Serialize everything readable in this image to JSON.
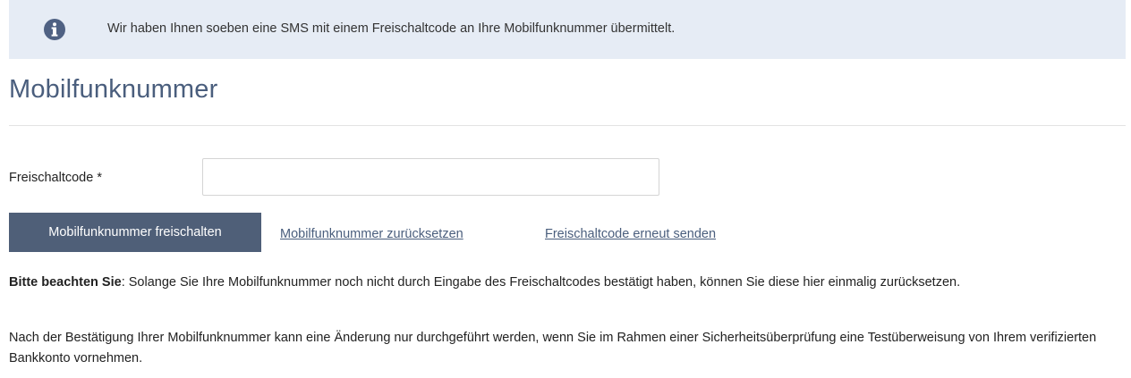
{
  "alert": {
    "icon": "info-circle-icon",
    "color": "#e6ecf5",
    "message": "Wir haben Ihnen soeben eine SMS mit einem Freischaltcode an Ihre Mobilfunknummer übermittelt."
  },
  "page": {
    "title": "Mobilfunknummer"
  },
  "form": {
    "code_label": "Freischaltcode *",
    "code_value": "",
    "code_placeholder": "",
    "submit_label": "Mobilfunknummer freischalten",
    "submit_color": "#4f5f78",
    "reset_link": "Mobilfunknummer zurücksetzen",
    "resend_link": "Freischaltcode erneut senden"
  },
  "notes": {
    "first_bold": "Bitte beachten Sie",
    "first_text": ": Solange Sie Ihre Mobilfunknummer noch nicht durch Eingabe des Freischaltcodes bestätigt haben, können Sie diese hier einmalig zurücksetzen.",
    "second_text": "Nach der Bestätigung Ihrer Mobilfunknummer kann eine Änderung nur durchgeführt werden, wenn Sie im Rahmen einer Sicherheitsüberprüfung eine Testüberweisung von Ihrem verifizierten Bankkonto vornehmen."
  }
}
